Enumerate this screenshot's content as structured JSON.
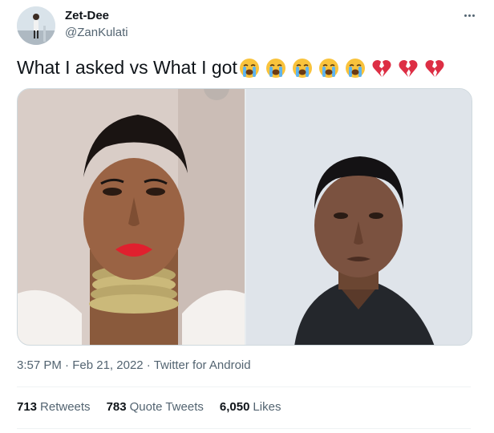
{
  "author": {
    "name": "Zet-Dee",
    "handle": "@ZanKulati"
  },
  "tweet": {
    "text": "What I asked vs What I got",
    "emojis": [
      "loudly-crying-face",
      "loudly-crying-face",
      "loudly-crying-face",
      "loudly-crying-face",
      "loudly-crying-face",
      "broken-heart",
      "broken-heart",
      "broken-heart"
    ]
  },
  "meta": {
    "time": "3:57 PM",
    "separator": "·",
    "date": "Feb 21, 2022",
    "source": "Twitter for Android"
  },
  "stats": {
    "retweets_count": "713",
    "retweets_label": "Retweets",
    "quotes_count": "783",
    "quotes_label": "Quote Tweets",
    "likes_count": "6,050",
    "likes_label": "Likes"
  },
  "colors": {
    "text_primary": "#0f1419",
    "text_secondary": "#536471",
    "divider": "#eff3f4"
  }
}
